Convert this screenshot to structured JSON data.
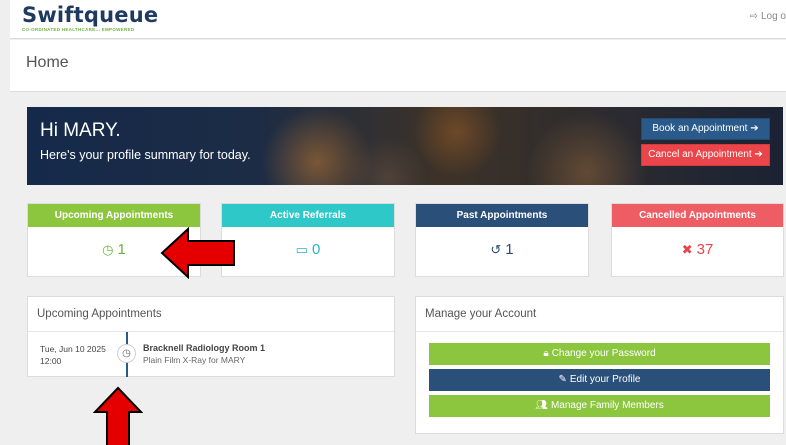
{
  "header": {
    "logo_text": "Swiftqueue",
    "logo_tagline": "CO-ORDINATED HEALTHCARE... EMPOWERED",
    "logout_label": "Log o",
    "logout_icon": "sign-out-icon"
  },
  "page": {
    "title": "Home"
  },
  "banner": {
    "greeting": "Hi MARY.",
    "summary": "Here's your profile summary for today.",
    "book_button": "Book an Appointment ➔",
    "cancel_button": "Cancel an Appointment ➔"
  },
  "stats": [
    {
      "label": "Upcoming Appointments",
      "icon": "clock-icon",
      "glyph": "◷",
      "value": "1",
      "color": "#8cc63f"
    },
    {
      "label": "Active Referrals",
      "icon": "calendar-icon",
      "glyph": "▭",
      "value": "0",
      "color": "#2ec8c8"
    },
    {
      "label": "Past Appointments",
      "icon": "history-icon",
      "glyph": "↺",
      "value": "1",
      "color": "#2a4f78"
    },
    {
      "label": "Cancelled Appointments",
      "icon": "times-circle-icon",
      "glyph": "✖",
      "value": "37",
      "color": "#ef5d64"
    }
  ],
  "upcoming_panel": {
    "title": "Upcoming Appointments",
    "appointment": {
      "date": "Tue, Jun 10 2025",
      "time": "12:00",
      "location": "Bracknell Radiology Room 1",
      "description": "Plain Film X-Ray for MARY"
    }
  },
  "account_panel": {
    "title": "Manage your Account",
    "buttons": [
      {
        "label": "Change your Password",
        "icon": "lock-icon",
        "glyph": "🔒"
      },
      {
        "label": "Edit your Profile",
        "icon": "edit-icon",
        "glyph": "✎"
      },
      {
        "label": "Manage Family Members",
        "icon": "users-icon",
        "glyph": "👥"
      }
    ]
  },
  "annotations": {
    "arrow_color": "#e50000"
  }
}
